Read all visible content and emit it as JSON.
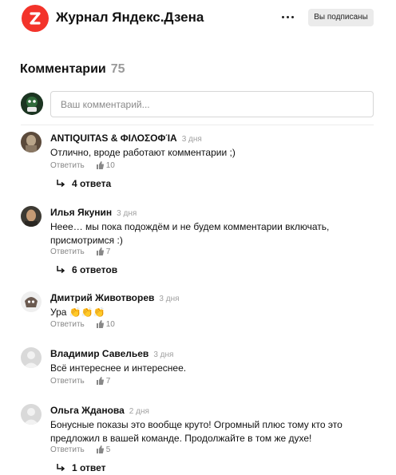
{
  "header": {
    "brand": "Журнал Яндекс.Дзена",
    "subscribe_label": "Вы подписаны"
  },
  "comments_section": {
    "title": "Комментарии",
    "count": "75",
    "input_placeholder": "Ваш комментарий..."
  },
  "comments": [
    {
      "author": "ANTIQUITAS & ΦΙΛΟΣΟΦΊΑ",
      "time": "3 дня",
      "text": "Отлично, вроде работают комментарии ;)",
      "reply_label": "Ответить",
      "likes": "10",
      "replies": "4 ответа"
    },
    {
      "author": "Илья Якунин",
      "time": "3 дня",
      "text": "Нееe… мы пока подождём и не будем комментарии включать, присмотримся :)",
      "reply_label": "Ответить",
      "likes": "7",
      "replies": "6 ответов"
    },
    {
      "author": "Дмитрий Животворев",
      "time": "3 дня",
      "text": "Ура 👏👏👏",
      "reply_label": "Ответить",
      "likes": "10"
    },
    {
      "author": "Владимир Савельев",
      "time": "3 дня",
      "text": "Всё интереснее и интереснее.",
      "reply_label": "Ответить",
      "likes": "7"
    },
    {
      "author": "Ольга Жданова",
      "time": "2 дня",
      "text": "Бонусные показы это вообще круто! Огромный плюс тому кто это предложил в вашей команде. Продолжайте в том же духе!",
      "reply_label": "Ответить",
      "likes": "5",
      "replies": "1 ответ"
    }
  ],
  "icons": {
    "logo": "zen-logo-icon",
    "menu": "more-dots-icon",
    "like": "thumbs-up-icon",
    "replies": "reply-arrow-icon",
    "avatar_placeholder": "user-silhouette-icon"
  },
  "colors": {
    "brand_red": "#f3332a",
    "muted_text": "#888888",
    "button_bg": "#ebebeb"
  }
}
